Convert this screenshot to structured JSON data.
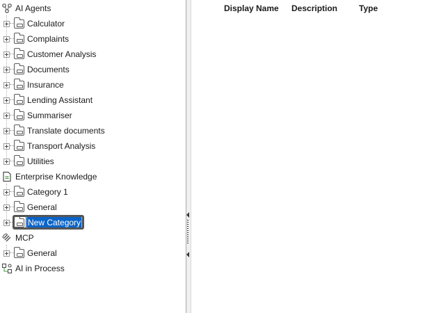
{
  "tree": {
    "roots": [
      {
        "label": "AI Agents",
        "icon": "ai-agents-icon",
        "children": [
          "Calculator",
          "Complaints",
          "Customer Analysis",
          "Documents",
          "Insurance",
          "Lending Assistant",
          "Summariser",
          "Translate documents",
          "Transport Analysis",
          "Utilities"
        ]
      },
      {
        "label": "Enterprise Knowledge",
        "icon": "document-icon",
        "children": [
          "Category 1",
          "General"
        ],
        "editing_child": "New Category"
      },
      {
        "label": "MCP",
        "icon": "mcp-icon",
        "children": [
          "General"
        ]
      },
      {
        "label": "AI in Process",
        "icon": "process-icon",
        "children": []
      }
    ]
  },
  "list": {
    "columns": [
      "Display Name",
      "Description",
      "Type"
    ]
  },
  "colors": {
    "selection": "#0a64c8",
    "border": "#a9a9a9"
  }
}
